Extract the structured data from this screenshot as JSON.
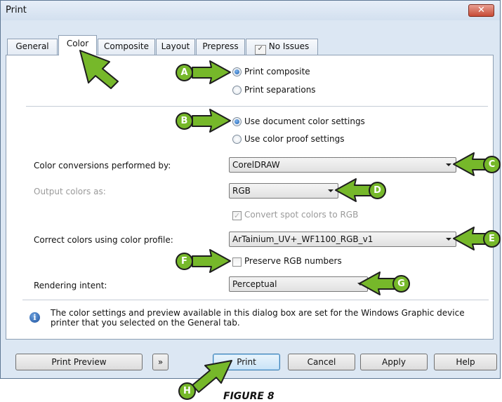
{
  "window": {
    "title": "Print",
    "close_label": "✕"
  },
  "tabs": [
    {
      "label": "General"
    },
    {
      "label": "Color"
    },
    {
      "label": "Composite"
    },
    {
      "label": "Layout"
    },
    {
      "label": "Prepress"
    },
    {
      "label": "No Issues",
      "icon": "issues-check-icon"
    }
  ],
  "active_tab": "Color",
  "print_mode": {
    "composite_label": "Print composite",
    "separations_label": "Print separations",
    "selected": "composite"
  },
  "color_settings": {
    "document_label": "Use document color settings",
    "proof_label": "Use color proof settings",
    "selected": "document"
  },
  "conversions": {
    "label": "Color conversions performed by:",
    "value": "CorelDRAW"
  },
  "output": {
    "label": "Output colors as:",
    "value": "RGB"
  },
  "convert_spot": {
    "label": "Convert spot colors to RGB",
    "checked": true,
    "disabled": true
  },
  "profile": {
    "label": "Correct colors using color profile:",
    "value": "ArTainium_UV+_WF1100_RGB_v1"
  },
  "preserve_rgb": {
    "label": "Preserve RGB numbers",
    "checked": false
  },
  "intent": {
    "label": "Rendering intent:",
    "value": "Perceptual"
  },
  "info_note": "The color settings and preview available in this dialog box are set for the Windows Graphic device printer that you selected on the General tab.",
  "buttons": {
    "print_preview": "Print Preview",
    "expand": "»",
    "print": "Print",
    "cancel": "Cancel",
    "apply": "Apply",
    "help": "Help"
  },
  "callouts": [
    "A",
    "B",
    "C",
    "D",
    "E",
    "F",
    "G",
    "H"
  ],
  "callout_color": "#76b82a",
  "caption": "FIGURE 8"
}
